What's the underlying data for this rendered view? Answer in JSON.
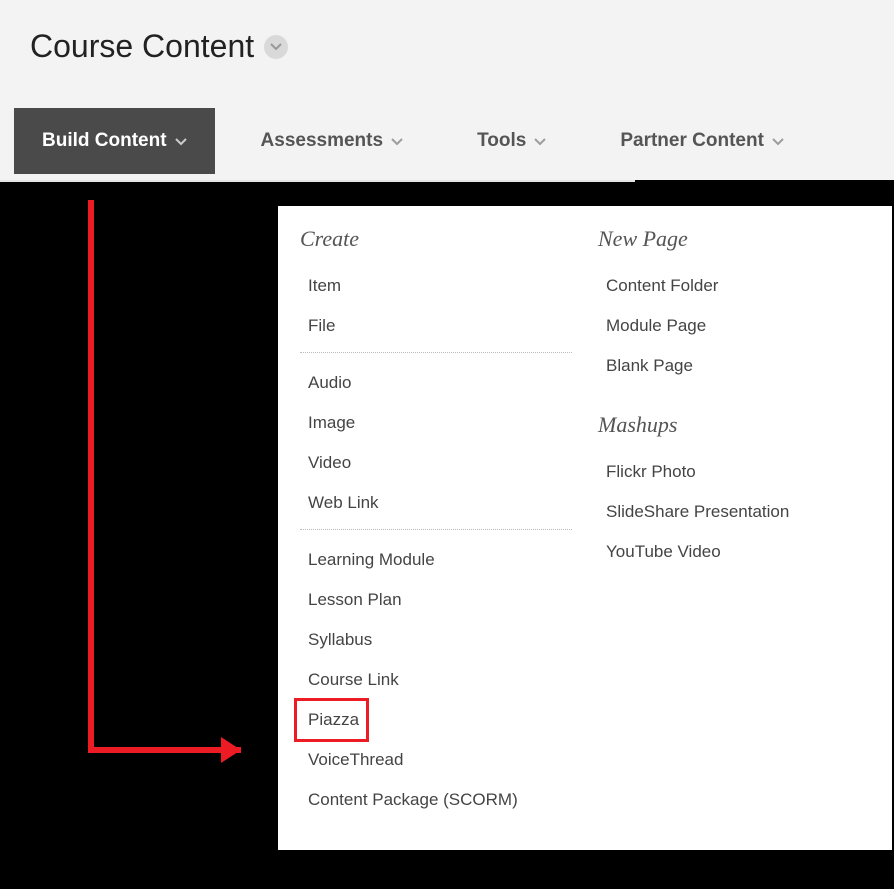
{
  "page_title": "Course Content",
  "tabs": {
    "build": "Build Content",
    "assess": "Assessments",
    "tools": "Tools",
    "partner": "Partner Content"
  },
  "dropdown": {
    "create_heading": "Create",
    "create_group1": {
      "item": "Item",
      "file": "File"
    },
    "create_group2": {
      "audio": "Audio",
      "image": "Image",
      "video": "Video",
      "weblink": "Web Link"
    },
    "create_group3": {
      "lm": "Learning Module",
      "lp": "Lesson Plan",
      "syl": "Syllabus",
      "cl": "Course Link",
      "piazza": "Piazza",
      "vt": "VoiceThread",
      "scorm": "Content Package (SCORM)"
    },
    "newpage_heading": "New Page",
    "newpage": {
      "cf": "Content Folder",
      "mp": "Module Page",
      "bp": "Blank Page"
    },
    "mashups_heading": "Mashups",
    "mashups": {
      "fp": "Flickr Photo",
      "ss": "SlideShare Presentation",
      "yt": "YouTube Video"
    }
  },
  "annotation": {
    "highlighted_item": "piazza",
    "arrow_color": "#ed1c24"
  }
}
